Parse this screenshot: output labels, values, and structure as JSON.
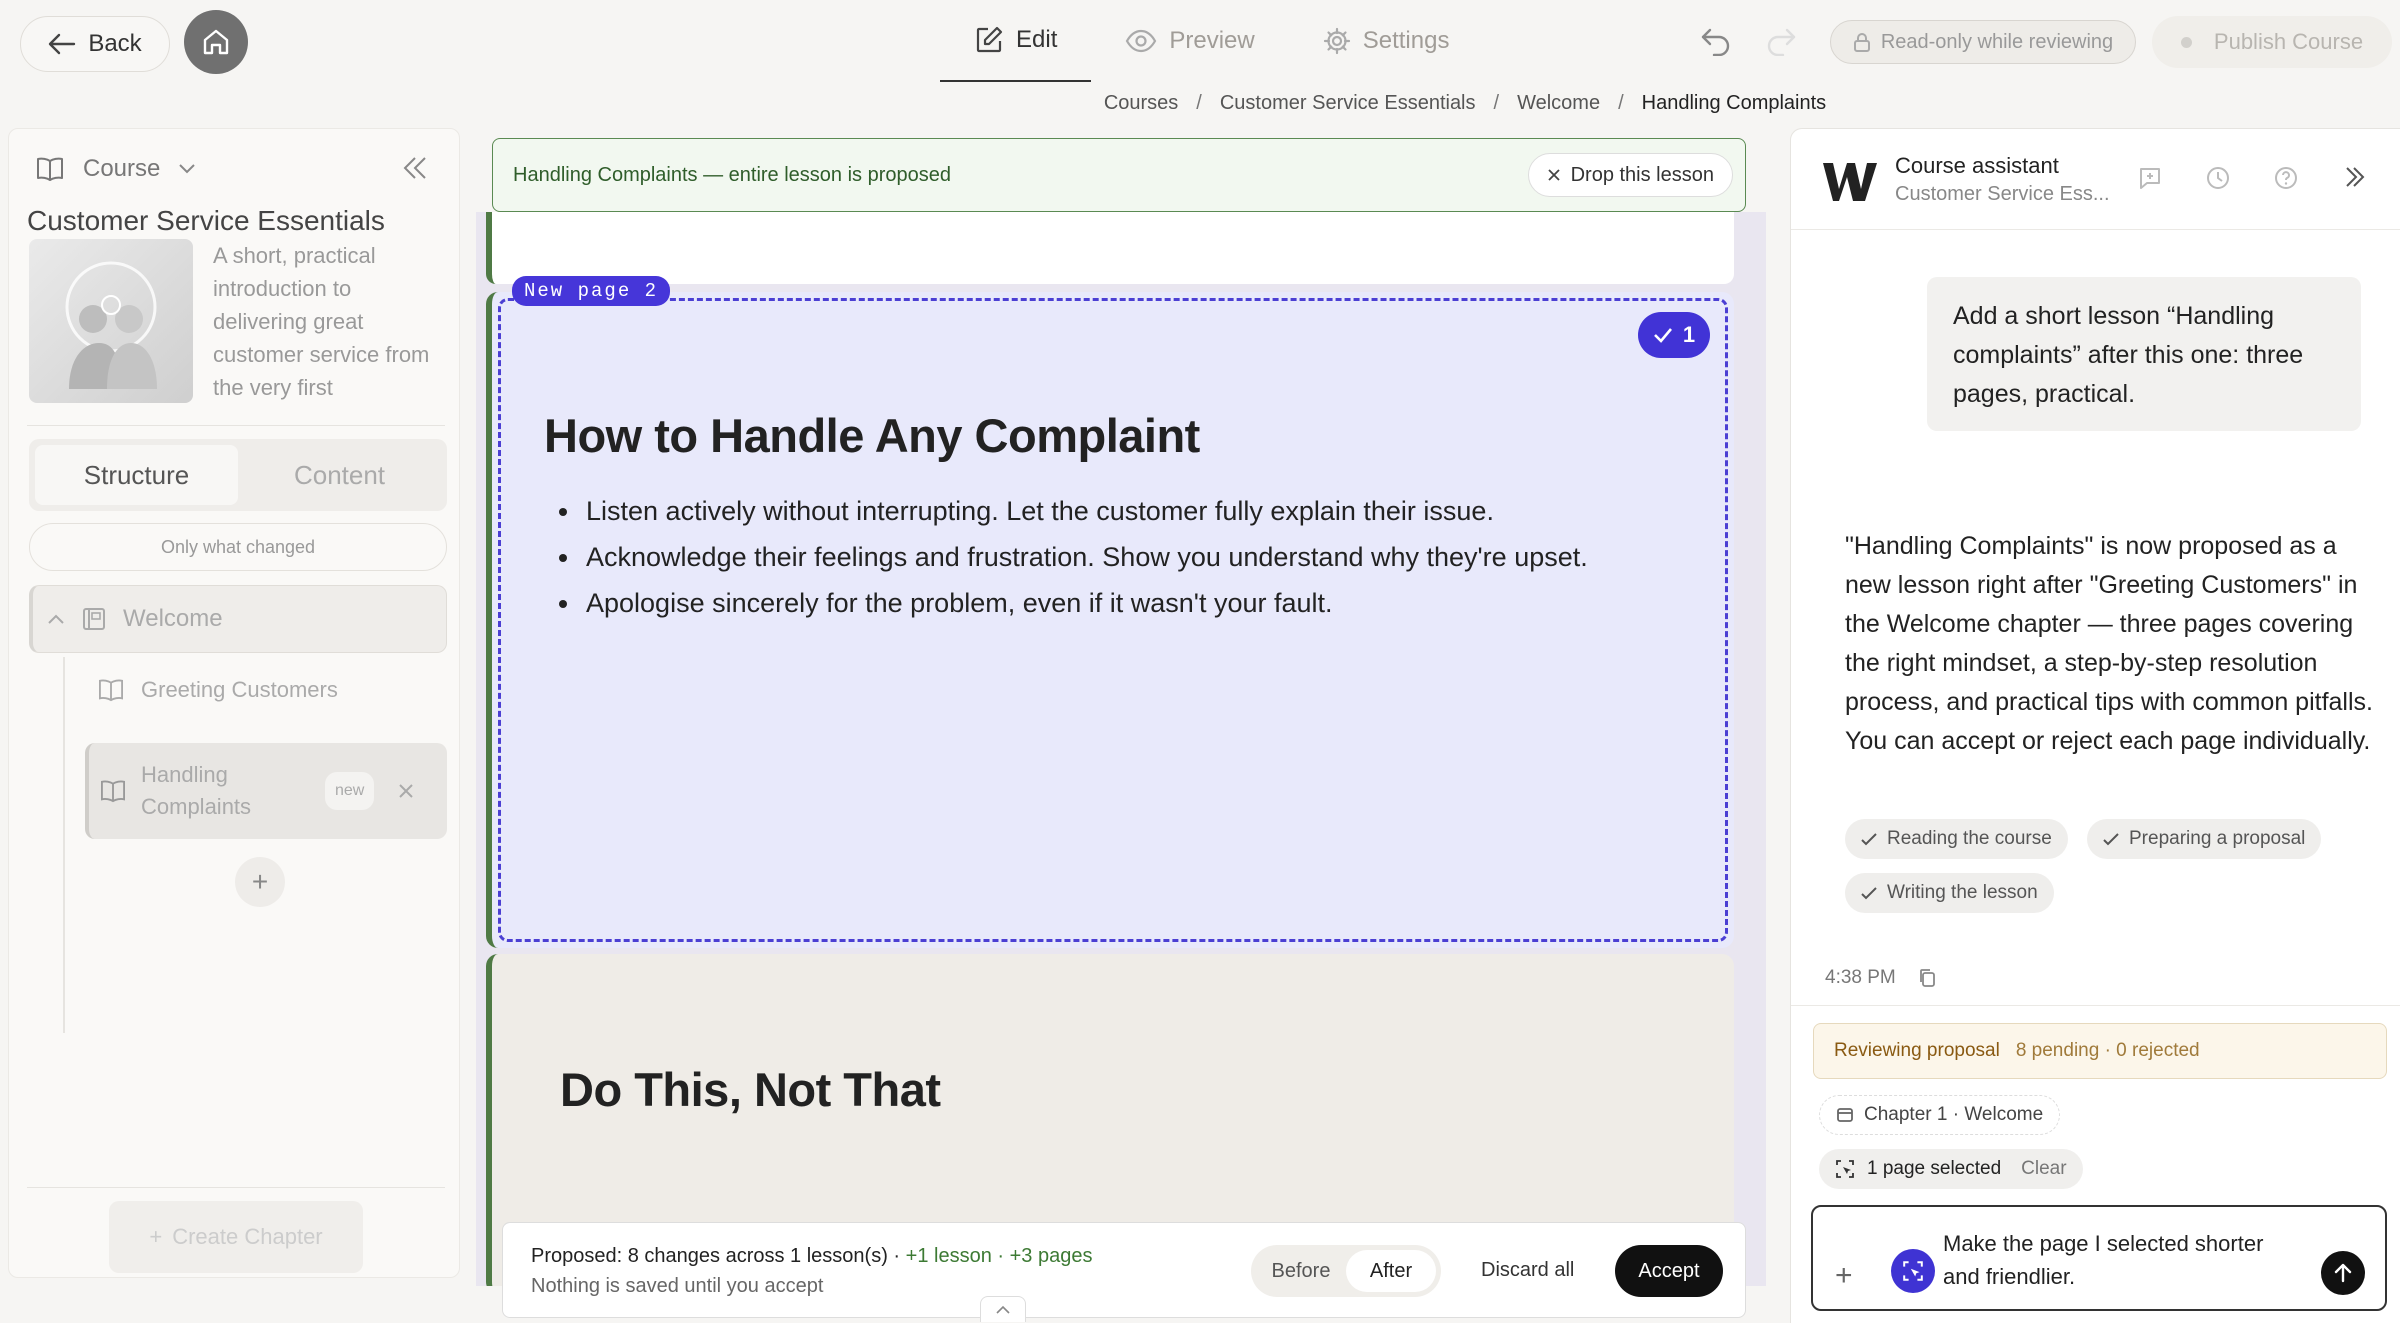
{
  "topbar": {
    "back_label": "Back",
    "tabs": [
      {
        "label": "Edit",
        "icon": "edit-icon"
      },
      {
        "label": "Preview",
        "icon": "eye-icon"
      },
      {
        "label": "Settings",
        "icon": "gear-icon"
      }
    ],
    "readonly_label": "Read-only while reviewing",
    "publish_label": "Publish Course"
  },
  "breadcrumb": [
    "Courses",
    "Customer Service Essentials",
    "Welcome",
    "Handling Complaints"
  ],
  "sidebar": {
    "course_label": "Course",
    "course_title": "Customer Service Essentials",
    "course_desc": "A short, practical introduction to delivering great customer service from the very first",
    "seg": {
      "structure": "Structure",
      "content": "Content"
    },
    "only_changed": "Only what changed",
    "chapter": "Welcome",
    "lessons": [
      {
        "label": "Greeting Customers"
      },
      {
        "label": "Handling Complaints",
        "badge": "new"
      }
    ],
    "add_label": "+",
    "create_chapter": "Create Chapter"
  },
  "banner": {
    "text": "Handling Complaints — entire lesson is proposed",
    "drop_label": "Drop this lesson"
  },
  "page2": {
    "tag": "New page 2",
    "badge_count": "1",
    "title": "How to Handle Any Complaint",
    "bullets": [
      "Listen actively without interrupting. Let the customer fully explain their issue.",
      "Acknowledge their feelings and frustration. Show you understand why they're upset.",
      "Apologise sincerely for the problem, even if it wasn't your fault."
    ]
  },
  "page3": {
    "title": "Do This, Not That"
  },
  "bottombar": {
    "summary": "Proposed: 8 changes across 1 lesson(s) · ",
    "added": "+1 lesson · +3 pages",
    "note": "Nothing is saved until you accept",
    "before": "Before",
    "after": "After",
    "discard": "Discard all",
    "accept": "Accept"
  },
  "assistant": {
    "name": "Course assistant",
    "sub": "Customer Service Ess...",
    "user_msg": "Add a short lesson “Handling complaints” after this one: three pages, practical.",
    "reply": "\"Handling Complaints\" is now proposed as a new lesson right after \"Greeting Customers\" in the Welcome chapter — three pages covering the right mindset, a step-by-step resolution process, and practical tips with common pitfalls. You can accept or reject each page individually.",
    "steps": [
      "Reading the course",
      "Preparing a proposal",
      "Writing the lesson"
    ],
    "time": "4:38 PM",
    "review_label": "Reviewing proposal",
    "review_status": "8 pending · 0 rejected",
    "chapter_chip": "Chapter 1 · Welcome",
    "selected": "1 page selected",
    "clear": "Clear",
    "composer_text": "Make the page I selected shorter and friendlier."
  },
  "colors": {
    "accent": "#4133d6",
    "proposed_green": "#4f7a45",
    "review_bg": "#fcf6ea"
  }
}
